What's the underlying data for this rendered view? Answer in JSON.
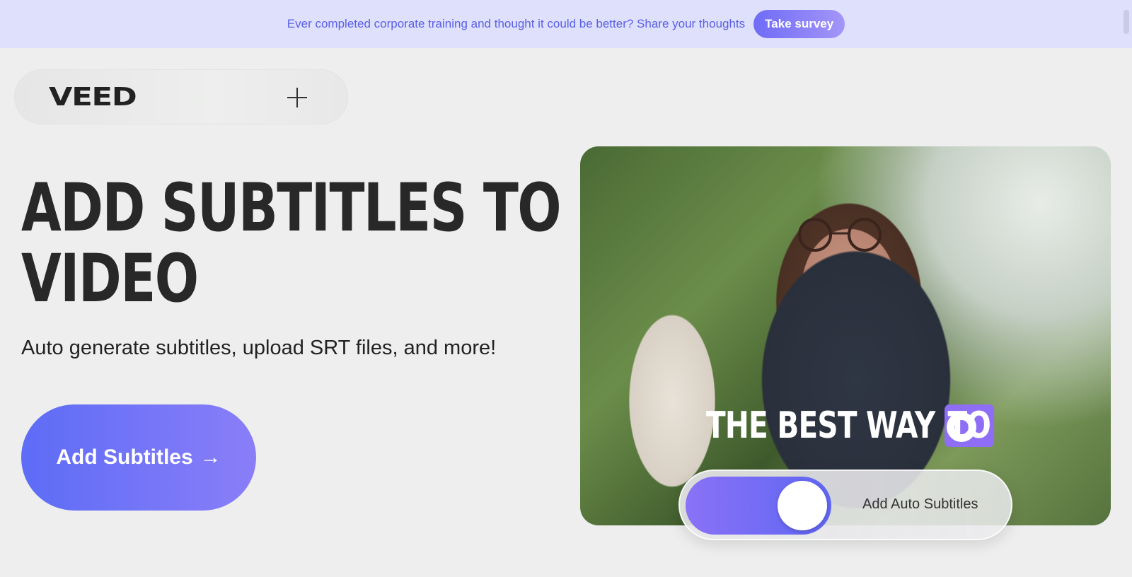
{
  "banner": {
    "text": "Ever completed corporate training and thought it could be better? Share your thoughts",
    "button_label": "Take survey"
  },
  "nav": {
    "logo": "VEED",
    "menu_icon": "plus-icon"
  },
  "hero": {
    "headline_line1": "ADD SUBTITLES TO",
    "headline_line2": "VIDEO",
    "subtitle": "Auto generate subtitles, upload SRT files, and more!",
    "cta_label": "Add Subtitles",
    "cta_icon": "arrow-right-icon"
  },
  "media": {
    "caption_main": "THE BEST WAY ",
    "caption_highlight": "TO",
    "toggle_label": "Add Auto Subtitles",
    "toggle_on": true
  },
  "colors": {
    "banner_bg": "#dfe0fb",
    "accent": "#6f6cf7",
    "page_bg": "#edeeed"
  }
}
